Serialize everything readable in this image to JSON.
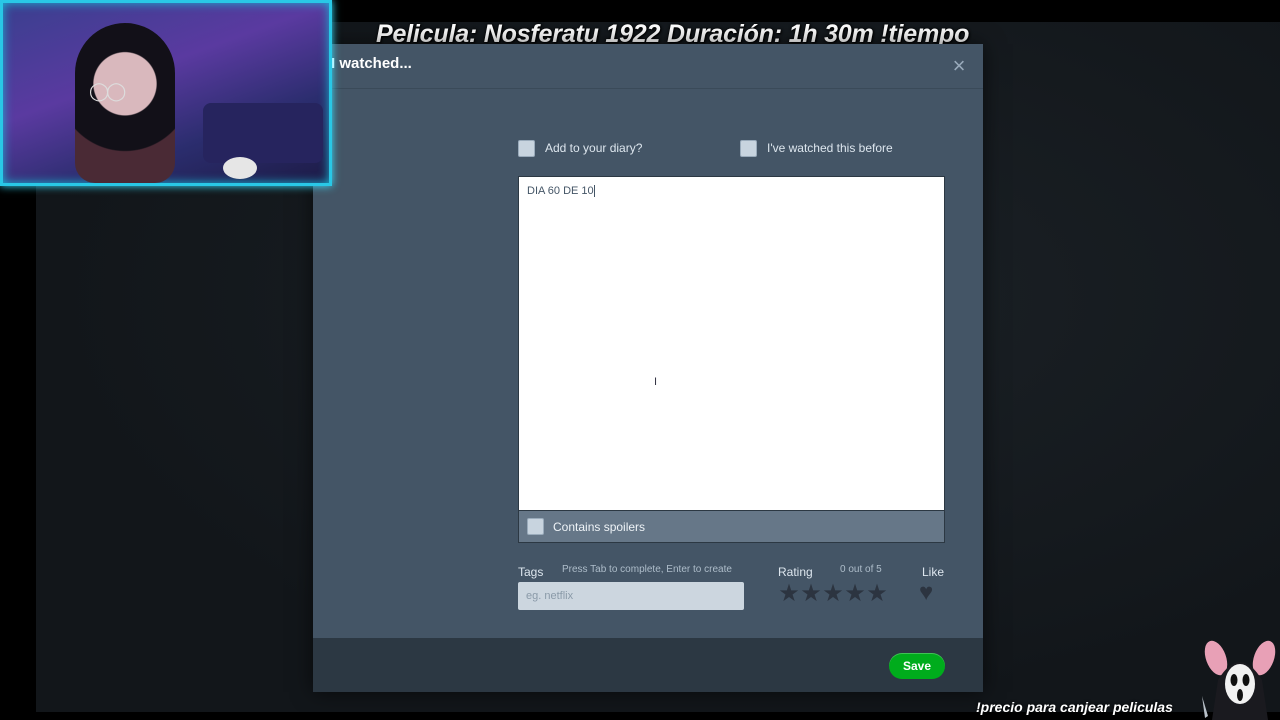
{
  "stream": {
    "title": "Pelicula: Nosferatu 1922  Duración: 1h 30m  !tiempo",
    "bottom_text": "!precio para canjear peliculas"
  },
  "modal": {
    "title": "I watched...",
    "close_glyph": "×",
    "add_to_diary_label": "Add to your diary?",
    "add_to_diary_checked": false,
    "watched_before_label": "I've watched this before",
    "watched_before_checked": false,
    "review_text": "DIA 60 DE 10",
    "contains_spoilers_label": "Contains spoilers",
    "contains_spoilers_checked": false,
    "tags": {
      "label": "Tags",
      "hint": "Press Tab to complete, Enter to create",
      "placeholder": "eg. netflix"
    },
    "rating": {
      "label": "Rating",
      "count": "0 out of 5",
      "value": 0,
      "max": 5
    },
    "like": {
      "label": "Like",
      "liked": false
    },
    "save_label": "Save"
  },
  "colors": {
    "modal_bg": "#445566",
    "footer_bg": "#2c3843",
    "save_green": "#00ac1c",
    "webcam_border": "#29c8e6"
  },
  "icons": {
    "close": "close-icon",
    "star": "star-icon",
    "heart": "heart-icon",
    "text_cursor": "text-cursor-icon"
  }
}
